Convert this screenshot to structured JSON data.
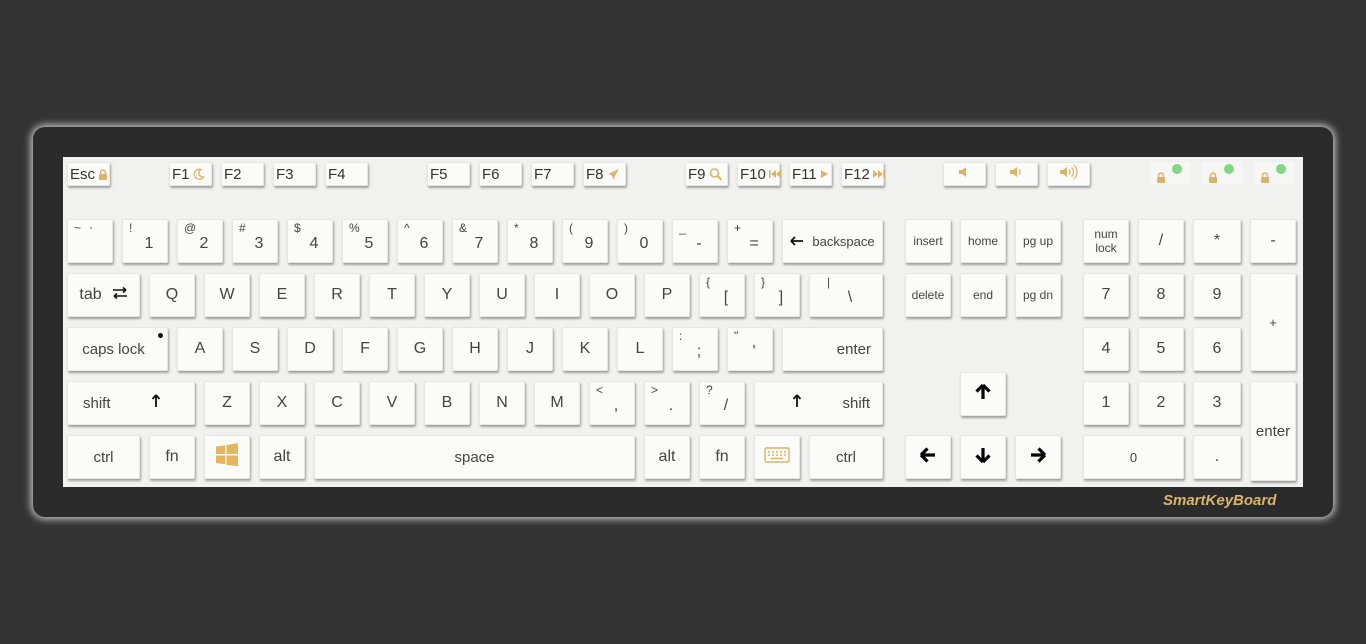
{
  "brand": "SmartKeyBoard",
  "colors": {
    "accent": "#d9b46a",
    "led": "#7fd77f",
    "body": "#2b2b2b",
    "key": "#fbfbf9"
  },
  "function_row": {
    "esc": "Esc",
    "f1": "F1",
    "f2": "F2",
    "f3": "F3",
    "f4": "F4",
    "f5": "F5",
    "f6": "F6",
    "f7": "F7",
    "f8": "F8",
    "f9": "F9",
    "f10": "F10",
    "f11": "F11",
    "f12": "F12"
  },
  "number_row": {
    "tilde": {
      "shift": "~",
      "main": "`"
    },
    "k1": {
      "shift": "!",
      "main": "1"
    },
    "k2": {
      "shift": "@",
      "main": "2"
    },
    "k3": {
      "shift": "#",
      "main": "3"
    },
    "k4": {
      "shift": "$",
      "main": "4"
    },
    "k5": {
      "shift": "%",
      "main": "5"
    },
    "k6": {
      "shift": "^",
      "main": "6"
    },
    "k7": {
      "shift": "&",
      "main": "7"
    },
    "k8": {
      "shift": "*",
      "main": "8"
    },
    "k9": {
      "shift": "(",
      "main": "9"
    },
    "k0": {
      "shift": ")",
      "main": "0"
    },
    "minus": {
      "shift": "_",
      "main": "-"
    },
    "equals": {
      "shift": "+",
      "main": "="
    },
    "backspace": "backspace"
  },
  "qwerty_row": {
    "tab": "tab",
    "letters": [
      "Q",
      "W",
      "E",
      "R",
      "T",
      "Y",
      "U",
      "I",
      "O",
      "P"
    ],
    "lbracket": {
      "shift": "{",
      "main": "["
    },
    "rbracket": {
      "shift": "}",
      "main": "]"
    },
    "backslash": {
      "shift": "|",
      "main": "\\"
    }
  },
  "home_row": {
    "capslock": "caps lock",
    "letters": [
      "A",
      "S",
      "D",
      "F",
      "G",
      "H",
      "J",
      "K",
      "L"
    ],
    "semicolon": {
      "shift": ":",
      "main": ";"
    },
    "quote": {
      "shift": "\"",
      "main": "'"
    },
    "enter": "enter"
  },
  "shift_row": {
    "lshift": "shift",
    "letters": [
      "Z",
      "X",
      "C",
      "V",
      "B",
      "N",
      "M"
    ],
    "comma": {
      "shift": "<",
      "main": ","
    },
    "period": {
      "shift": ">",
      "main": "."
    },
    "slash": {
      "shift": "?",
      "main": "/"
    },
    "rshift": "shift"
  },
  "bottom_row": {
    "lctrl": "ctrl",
    "lfn": "fn",
    "lalt": "alt",
    "space": "space",
    "ralt": "alt",
    "rfn": "fn",
    "rctrl": "ctrl"
  },
  "nav_cluster": {
    "insert": "insert",
    "home": "home",
    "pgup": "pg up",
    "delete": "delete",
    "end": "end",
    "pgdn": "pg dn"
  },
  "numpad": {
    "numlock_line1": "num",
    "numlock_line2": "lock",
    "divide": "/",
    "multiply": "*",
    "subtract": "-",
    "n7": "7",
    "n8": "8",
    "n9": "9",
    "add": "+",
    "n4": "4",
    "n5": "5",
    "n6": "6",
    "n1": "1",
    "n2": "2",
    "n3": "3",
    "enter": "enter",
    "n0": "0",
    "decimal": "."
  },
  "icons": {
    "esc": "lock-icon",
    "f1": "moon-icon",
    "f8": "airplane-icon",
    "f9": "search-icon",
    "f10": "previous-track-icon",
    "f11": "play-icon",
    "f12": "next-track-icon",
    "mute": "speaker-mute-icon",
    "vol_down": "volume-down-icon",
    "vol_up": "volume-up-icon",
    "windows": "windows-icon",
    "keyboard": "keyboard-icon"
  }
}
